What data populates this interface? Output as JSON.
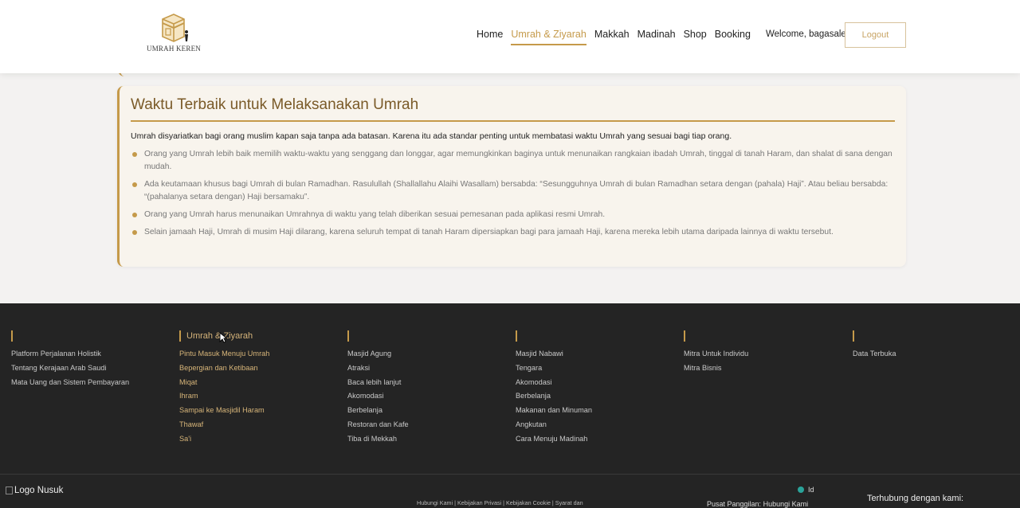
{
  "header": {
    "logo_text": "UMRAH KEREN",
    "nav": [
      {
        "label": "Home",
        "active": false
      },
      {
        "label": "Umrah & Ziyarah",
        "active": true
      },
      {
        "label": "Makkah",
        "active": false
      },
      {
        "label": "Madinah",
        "active": false
      },
      {
        "label": "Shop",
        "active": false
      },
      {
        "label": "Booking",
        "active": false
      }
    ],
    "welcome": "Welcome, bagasale",
    "logout_label": "Logout"
  },
  "card": {
    "title": "Waktu Terbaik untuk Melaksanakan Umrah",
    "intro": "Umrah disyariatkan bagi orang muslim kapan saja tanpa ada batasan. Karena itu ada standar penting untuk membatasi waktu Umrah yang sesuai bagi tiap orang.",
    "points": [
      "Orang yang Umrah lebih baik memilih waktu-waktu yang senggang dan longgar, agar memungkinkan baginya untuk menunaikan rangkaian ibadah Umrah, tinggal di tanah Haram, dan shalat di sana dengan mudah.",
      "Ada keutamaan khusus bagi Umrah di bulan Ramadhan. Rasulullah (Shallallahu Alaihi Wasallam) bersabda: “Sesungguhnya Umrah di bulan Ramadhan setara dengan (pahala) Haji”. Atau beliau bersabda: “(pahalanya setara dengan) Haji bersamaku”.",
      "Orang yang Umrah harus menunaikan Umrahnya di waktu yang telah diberikan sesuai pemesanan pada aplikasi resmi Umrah.",
      "Selain jamaah Haji, Umrah di musim Haji dilarang, karena seluruh tempat di tanah Haram dipersiapkan bagi para jamaah Haji, karena mereka lebih utama daripada lainnya di waktu tersebut."
    ]
  },
  "footer": {
    "columns": [
      {
        "heading": "",
        "items": [
          "Platform Perjalanan Holistik",
          "Tentang Kerajaan Arab Saudi",
          "Mata Uang dan Sistem Pembayaran"
        ]
      },
      {
        "heading": "Umrah & Ziyarah",
        "items": [
          "Pintu Masuk Menuju Umrah",
          "Bepergian dan Ketibaan",
          "Miqat",
          "Ihram",
          "Sampai ke Masjidil Haram",
          "Thawaf",
          "Sa'i"
        ]
      },
      {
        "heading": "",
        "items": [
          "Masjid Agung",
          "Atraksi",
          "Baca lebih lanjut",
          "Akomodasi",
          "Berbelanja",
          "Restoran dan Kafe",
          "Tiba di Mekkah"
        ]
      },
      {
        "heading": "",
        "items": [
          "Masjid Nabawi",
          "Tengara",
          "Akomodasi",
          "Berbelanja",
          "Makanan dan Minuman",
          "Angkutan",
          "Cara Menuju Madinah"
        ]
      },
      {
        "heading": "",
        "items": [
          "Mitra Untuk Individu",
          "Mitra Bisnis"
        ]
      },
      {
        "heading": "",
        "items": [
          "Data Terbuka"
        ]
      }
    ],
    "logo_alt": "Logo Nusuk",
    "legal_links": "Hubungi Kami | Kebijakan Privasi | Kebijakan Cookie | Syarat dan",
    "language": "Id",
    "call_center_label": "Pusat Panggilan:",
    "call_center_link": "Hubungi Kami",
    "contact_heading": "Terhubung dengan kami:"
  },
  "colors": {
    "accent": "#c59a4a",
    "footer_bg": "#242424",
    "card_bg": "#f8f4ed"
  }
}
